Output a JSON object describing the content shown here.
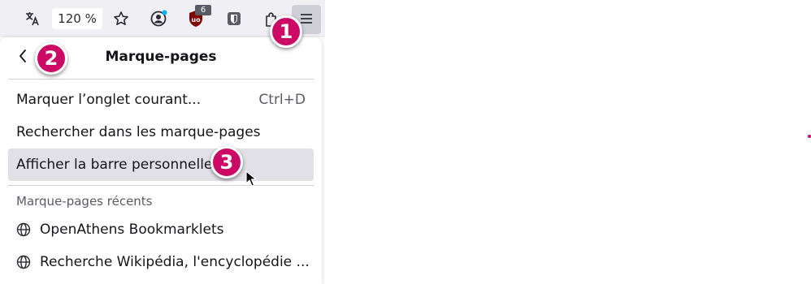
{
  "toolbar": {
    "zoom_level": "120 %",
    "extension_badge_count": "6",
    "icons": [
      "translate-icon",
      "star-icon",
      "account-icon",
      "ublock-icon",
      "bitwarden-icon",
      "extensions-icon",
      "hamburger-menu-icon"
    ]
  },
  "panel": {
    "title": "Marque-pages",
    "items": [
      {
        "label": "Marquer l’onglet courant...",
        "shortcut": "Ctrl+D"
      },
      {
        "label": "Rechercher dans les marque-pages"
      },
      {
        "label": "Afficher la barre personnelle"
      }
    ],
    "recent_section_label": "Marque-pages récents",
    "recent": [
      {
        "label": "OpenAthens Bookmarklets",
        "icon": "globe-icon"
      },
      {
        "label": "Recherche Wikipédia, l'encyclopédie ...",
        "icon": "globe-icon"
      }
    ]
  },
  "annotations": {
    "step1": "1",
    "step2": "2",
    "step3": "3"
  },
  "colors": {
    "accent": "#cc0a66",
    "toolbar_bg": "#f0f0f4",
    "menu_button_active": "#cfcfd8",
    "hover_bg": "#e0e0e6"
  }
}
